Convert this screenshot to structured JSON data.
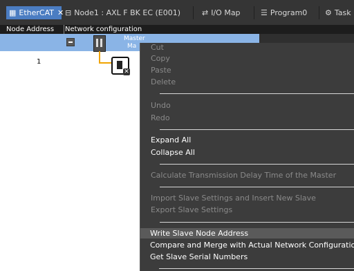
{
  "tabs": [
    {
      "label": "EtherCAT",
      "icon": "ethercat-icon",
      "active": true,
      "close": "✕"
    },
    {
      "label": "Node1 : AXL F BK EC (E001)",
      "icon": "node-icon"
    },
    {
      "label": "I/O Map",
      "icon": "io-map-icon"
    },
    {
      "label": "Program0",
      "icon": "program-icon"
    },
    {
      "label": "Task",
      "icon": "task-icon"
    }
  ],
  "columns": {
    "node_address": "Node Address",
    "network_configuration": "Network configuration"
  },
  "tree": {
    "master_label": "Master",
    "master_sublabel": "Ma",
    "node_number": "1"
  },
  "menu": {
    "cut": "Cut",
    "copy": "Copy",
    "paste": "Paste",
    "delete": "Delete",
    "undo": "Undo",
    "redo": "Redo",
    "expand_all": "Expand All",
    "collapse_all": "Collapse All",
    "calc_delay": "Calculate Transmission Delay Time of the Master",
    "import_slave": "Import Slave Settings and Insert New Slave",
    "export_slave": "Export Slave Settings",
    "write_node_address": "Write Slave Node Address",
    "compare_merge": "Compare and Merge with Actual Network Configuration",
    "get_serials": "Get Slave Serial Numbers"
  }
}
